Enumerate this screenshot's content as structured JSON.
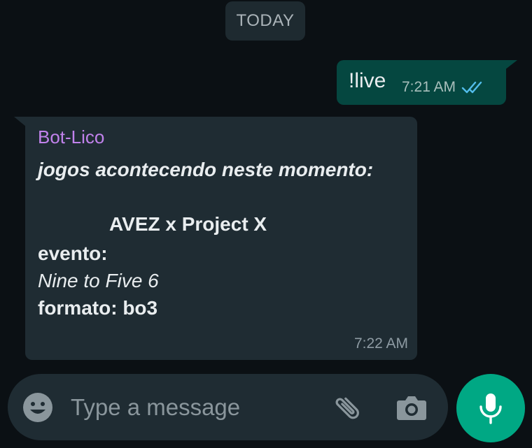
{
  "date_divider": "TODAY",
  "outgoing": {
    "text": "!live",
    "time": "7:21 AM",
    "status_icon": "double-check-read-icon"
  },
  "incoming": {
    "sender": "Bot-Lico",
    "lines": {
      "heading": "jogos acontecendo neste momento:",
      "match": "AVEZ x Project X",
      "event_label": "evento:",
      "event_value": "Nine to Five 6",
      "format": "formato: bo3"
    },
    "time": "7:22 AM"
  },
  "composer": {
    "placeholder": "Type a message",
    "value": "",
    "icons": {
      "emoji": "emoji-icon",
      "attach": "paperclip-icon",
      "camera": "camera-icon",
      "mic": "microphone-icon"
    }
  },
  "colors": {
    "background": "#0b1014",
    "outgoing_bubble": "#054740",
    "incoming_bubble": "#1f2c33",
    "sender_name": "#c182ec",
    "read_ticks": "#53bdeb",
    "mic_button": "#00a884"
  }
}
